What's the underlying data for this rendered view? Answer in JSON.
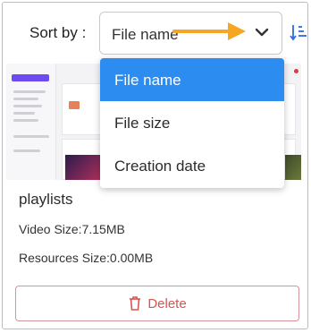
{
  "sort": {
    "label": "Sort by :",
    "selected": "File name",
    "options": [
      "File name",
      "File size",
      "Creation date"
    ]
  },
  "card": {
    "title": "playlists",
    "video_size": "Video Size:7.15MB",
    "resources_size": "Resources Size:0.00MB",
    "delete_label": "Delete"
  },
  "colors": {
    "accent": "#2d8cf0",
    "annotation_arrow": "#f5a623",
    "delete": "#d9534f"
  },
  "icons": {
    "chevron": "chevron-down-icon",
    "sort_order": "sort-order-icon",
    "trash": "trash-icon"
  }
}
